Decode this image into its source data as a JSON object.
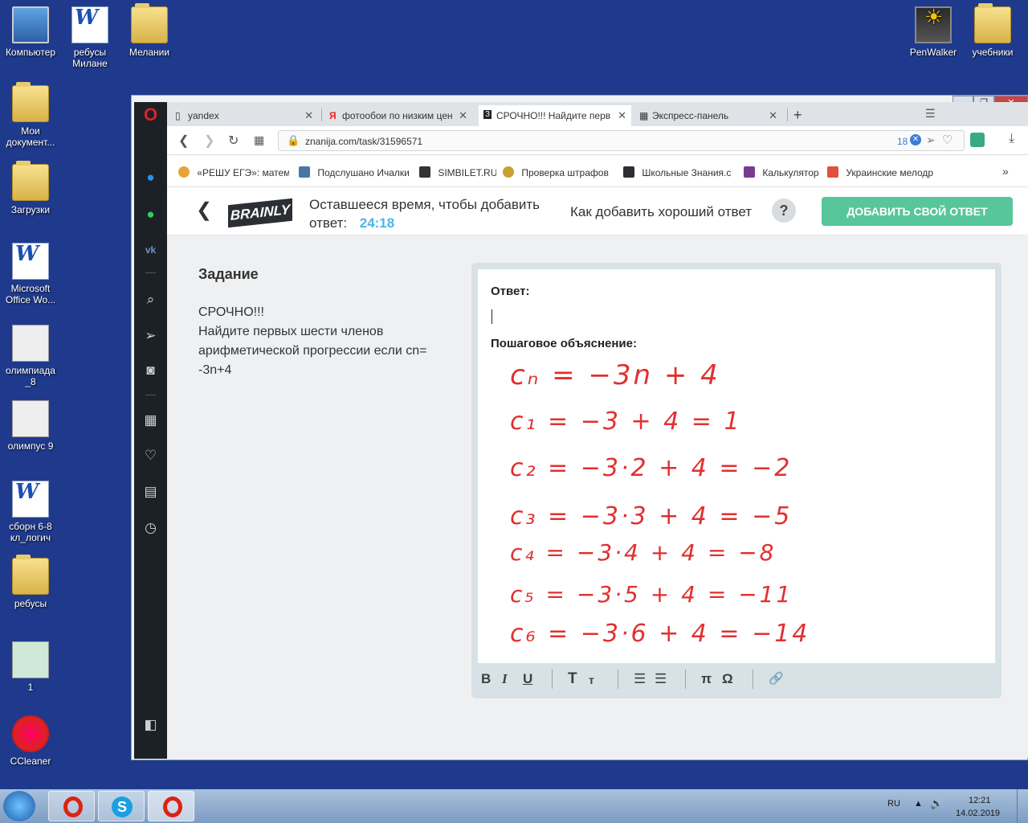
{
  "desktop": {
    "icons": [
      {
        "label": "Компьютер"
      },
      {
        "label": "ребусы Милане"
      },
      {
        "label": "Мелании"
      },
      {
        "label": "Мои документ..."
      },
      {
        "label": "Загрузки"
      },
      {
        "label": "Microsoft Office Wo..."
      },
      {
        "label": "олимпиада _8"
      },
      {
        "label": "олимпус 9"
      },
      {
        "label": "сборн 6-8 кл_логич"
      },
      {
        "label": "ребусы"
      },
      {
        "label": "1"
      },
      {
        "label": "CCleaner"
      },
      {
        "label": "PenWalker"
      },
      {
        "label": "учебники"
      }
    ]
  },
  "browser": {
    "tabs": [
      {
        "label": "yandex",
        "icon": "page-icon"
      },
      {
        "label": "фотообои по низким цен",
        "icon": "yandex-icon"
      },
      {
        "label": "СРОЧНО!!! Найдите перв",
        "icon": "znanija-icon"
      },
      {
        "label": "Экспресс-панель",
        "icon": "speed-dial-icon"
      }
    ],
    "url": "znanija.com/task/31596571",
    "badge_count": "18",
    "bookmarks": [
      {
        "label": "«РЕШУ ЕГЭ»: матема",
        "color": "#e8a33a"
      },
      {
        "label": "Подслушано Ичалки",
        "color": "#4a76a8"
      },
      {
        "label": "SIMBILET.RU",
        "color": "#333333"
      },
      {
        "label": "Проверка штрафов",
        "color": "#c8a030"
      },
      {
        "label": "Школьные Знания.с",
        "color": "#2b2f33"
      },
      {
        "label": "Калькулятор",
        "color": "#7a3b8f"
      },
      {
        "label": "Украинские мелодр",
        "color": "#e0503a"
      }
    ]
  },
  "page": {
    "logo": "BRAINLY",
    "timer_text": "Оставшееся время, чтобы добавить ответ:",
    "timer_value": "24:18",
    "how_link": "Как добавить хороший ответ",
    "help_mark": "?",
    "add_answer_button": "ДОБАВИТЬ СВОЙ ОТВЕТ",
    "task_heading": "Задание",
    "task_line1": "СРОЧНО!!!",
    "task_line2": "Найдите первых шести членов арифметической прогрессии если cn= -3n+4",
    "answer_label": "Ответ:",
    "explanation_label": "Пошаговое объяснение:",
    "handwritten": [
      "cₙ = −3n + 4",
      "c₁ = −3 + 4 = 1",
      "c₂ = −3·2 + 4 = −2",
      "c₃ = −3·3 + 4 = −5",
      "c₄ = −3·4 + 4 = −8",
      "c₅ = −3·5 + 4 = −11",
      "c₆ = −3·6 + 4 = −14"
    ],
    "toolbar": {
      "bold": "B",
      "italic": "I",
      "underline": "U",
      "text_large": "T",
      "text_small": "т",
      "ordered_list": "☰",
      "bullet_list": "☰",
      "pi": "π",
      "omega": "Ω",
      "attach": "🔗"
    }
  },
  "taskbar": {
    "lang": "RU",
    "time": "12:21",
    "date": "14.02.2019"
  }
}
